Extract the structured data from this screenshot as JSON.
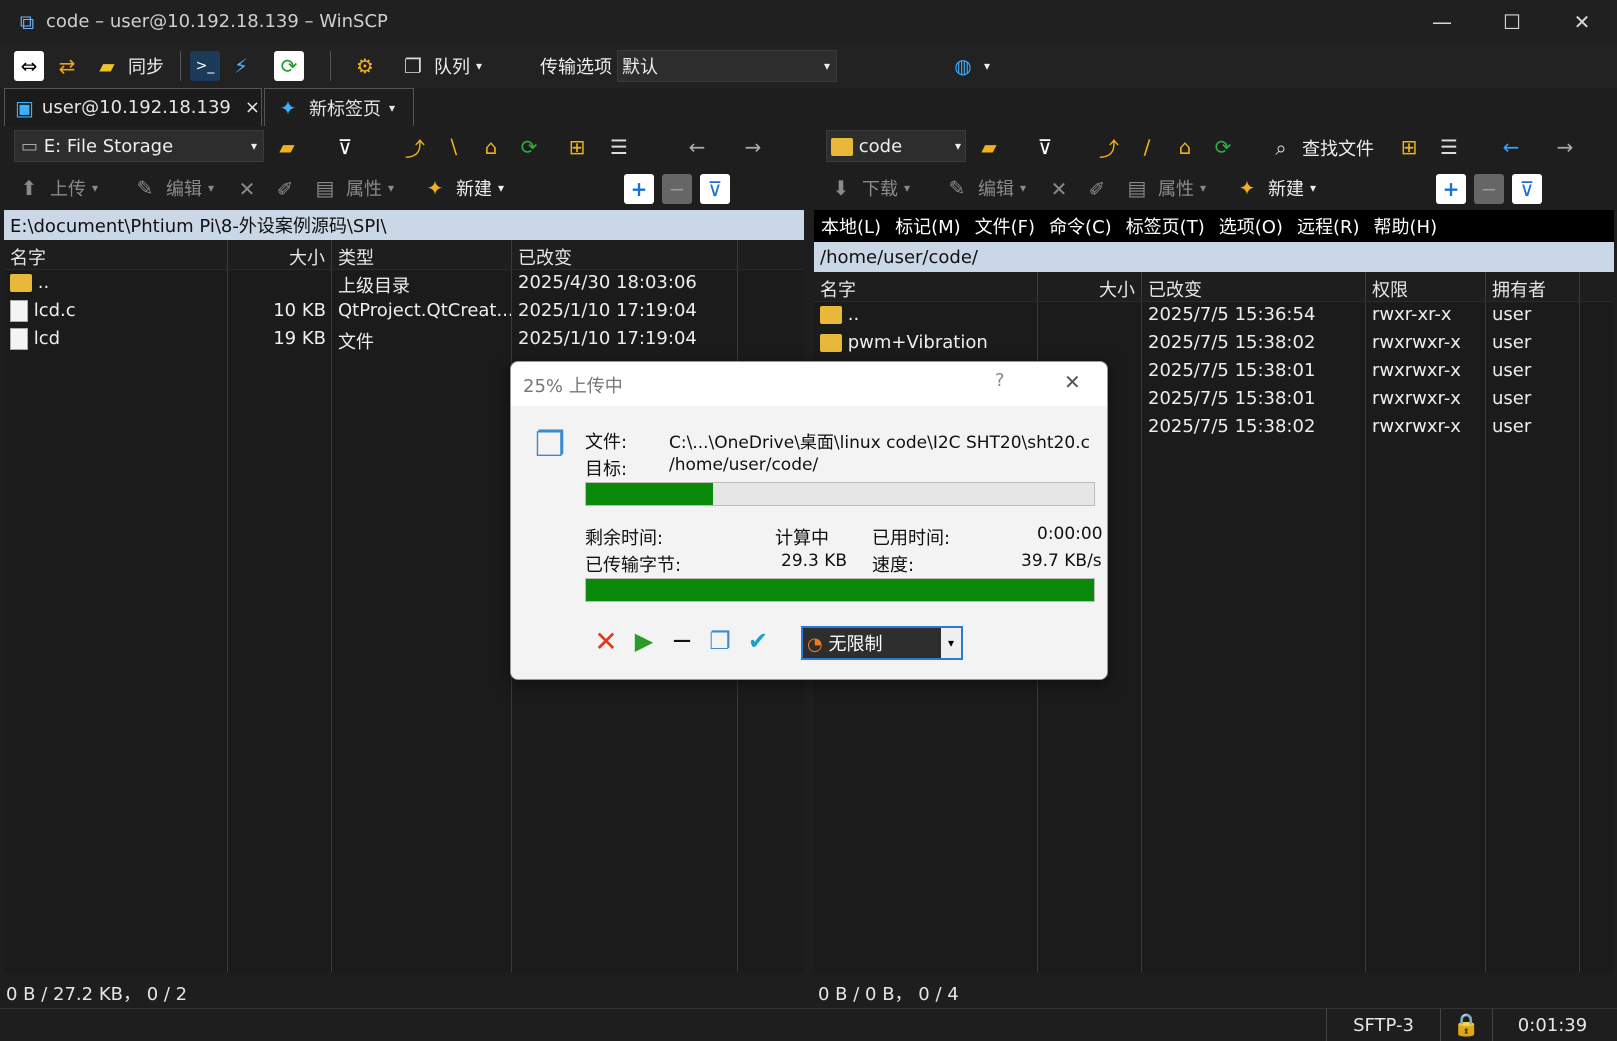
{
  "window": {
    "title": "code – user@10.192.18.139 – WinSCP",
    "minimize": "—",
    "maximize": "☐",
    "close": "✕"
  },
  "toolbar": {
    "sync_label": "同步",
    "queue_label": "队列",
    "transfer_options_label": "传输选项",
    "transfer_options_value": "默认"
  },
  "tabs": [
    {
      "label": "user@10.192.18.139",
      "close": "×"
    },
    {
      "label": "新标签页"
    }
  ],
  "left": {
    "drive": "E: File Storage",
    "buttons": {
      "upload": "上传",
      "edit": "编辑",
      "properties": "属性",
      "new": "新建"
    },
    "path": "E:\\document\\Phtium Pi\\8-外设案例源码\\SPI\\",
    "columns": [
      "名字",
      "大小",
      "类型",
      "已改变"
    ],
    "rows": [
      {
        "name": "..",
        "size": "",
        "type": "上级目录",
        "changed": "2025/4/30 18:03:06",
        "icon": "parent-folder"
      },
      {
        "name": "lcd.c",
        "size": "10 KB",
        "type": "QtProject.QtCreat...",
        "changed": "2025/1/10 17:19:04",
        "icon": "file"
      },
      {
        "name": "lcd",
        "size": "19 KB",
        "type": "文件",
        "changed": "2025/1/10 17:19:04",
        "icon": "file"
      }
    ],
    "status": "0 B / 27.2 KB， 0 / 2"
  },
  "right": {
    "folder": "code",
    "find_files": "查找文件",
    "buttons": {
      "download": "下载",
      "edit": "编辑",
      "properties": "属性",
      "new": "新建"
    },
    "menu": [
      "本地(L)",
      "标记(M)",
      "文件(F)",
      "命令(C)",
      "标签页(T)",
      "选项(O)",
      "远程(R)",
      "帮助(H)"
    ],
    "path": "/home/user/code/",
    "columns": [
      "名字",
      "大小",
      "已改变",
      "权限",
      "拥有者"
    ],
    "rows": [
      {
        "name": "..",
        "changed": "2025/7/5 15:36:54",
        "perm": "rwxr-xr-x",
        "owner": "user"
      },
      {
        "name": "pwm+Vibration",
        "changed": "2025/7/5 15:38:02",
        "perm": "rwxrwxr-x",
        "owner": "user"
      },
      {
        "name": "",
        "changed": "2025/7/5 15:38:01",
        "perm": "rwxrwxr-x",
        "owner": "user"
      },
      {
        "name": "",
        "changed": "2025/7/5 15:38:01",
        "perm": "rwxrwxr-x",
        "owner": "user"
      },
      {
        "name": "",
        "changed": "2025/7/5 15:38:02",
        "perm": "rwxrwxr-x",
        "owner": "user"
      }
    ],
    "status": "0 B / 0 B， 0 / 4"
  },
  "bottom": {
    "protocol": "SFTP-3",
    "elapsed": "0:01:39"
  },
  "dialog": {
    "title": "25% 上传中",
    "help": "?",
    "close": "✕",
    "file_label": "文件:",
    "file_value": "C:\\...\\OneDrive\\桌面\\linux code\\I2C SHT20\\sht20.c",
    "target_label": "目标:",
    "target_value": "/home/user/code/",
    "file_progress": 0.25,
    "remaining_label": "剩余时间:",
    "remaining_value": "计算中",
    "elapsed_label": "已用时间:",
    "elapsed_value": "0:00:00",
    "bytes_label": "已传输字节:",
    "bytes_value": "29.3 KB",
    "speed_label": "速度:",
    "speed_value": "39.7 KB/s",
    "total_progress": 1.0,
    "speed_limit": "无限制"
  }
}
